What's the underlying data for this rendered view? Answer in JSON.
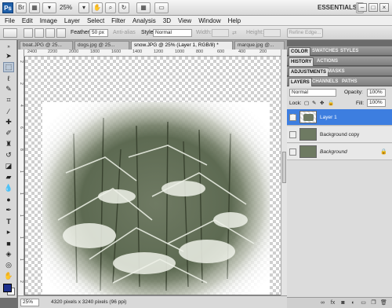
{
  "app": {
    "logo": "Ps",
    "zoom": "25%",
    "workspace": "ESSENTIALS"
  },
  "menu": [
    "File",
    "Edit",
    "Image",
    "Layer",
    "Select",
    "Filter",
    "Analysis",
    "3D",
    "View",
    "Window",
    "Help"
  ],
  "options": {
    "feather_label": "Feather:",
    "feather_value": "50 px",
    "anti_alias": "Anti-alias",
    "style_label": "Style:",
    "style_value": "Normal",
    "width_label": "Width:",
    "height_label": "Height:",
    "refine_edge": "Refine Edge..."
  },
  "doc_tabs": [
    "boat.JPG @ 25...",
    "dogs.jpg @ 25...",
    "snow.JPG @ 25% (Layer 1, RGB/8) *",
    "marque.jpg @..."
  ],
  "ruler": {
    "h_ticks": [
      "2400",
      "2200",
      "2000",
      "1800",
      "1600",
      "1400",
      "1200",
      "1000",
      "800",
      "600",
      "400",
      "200"
    ],
    "v_ticks": [
      "2",
      "2",
      "4",
      "6",
      "8",
      "1",
      "1",
      "1",
      "1",
      "1",
      "2"
    ]
  },
  "status": {
    "zoom": "25%",
    "info": "4320 pixels x 3240 pixels (96 ppi)"
  },
  "panels": {
    "group1_tabs": [
      "COLOR",
      "SWATCHES",
      "STYLES"
    ],
    "group2_tabs": [
      "HISTORY",
      "ACTIONS"
    ],
    "group3_tabs": [
      "ADJUSTMENTS",
      "MASKS"
    ],
    "group4_tabs": [
      "LAYERS",
      "CHANNELS",
      "PATHS"
    ],
    "blend_mode": "Normal",
    "opacity_label": "Opacity:",
    "opacity_value": "100%",
    "lock_label": "Lock:",
    "fill_label": "Fill:",
    "fill_value": "100%"
  },
  "layers": [
    {
      "name": "Layer 1",
      "selected": true
    },
    {
      "name": "Background copy",
      "selected": false
    },
    {
      "name": "Background",
      "selected": false,
      "locked": true
    }
  ]
}
